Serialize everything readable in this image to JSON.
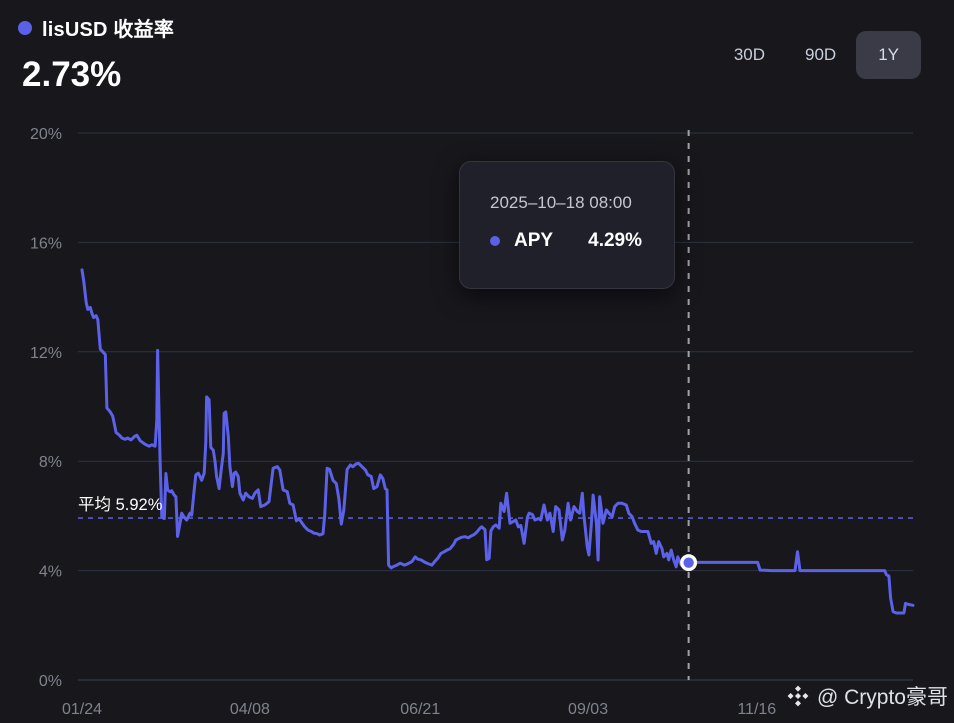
{
  "header": {
    "title": "lisUSD 收益率",
    "value": "2.73%",
    "ranges": [
      {
        "label": "30D",
        "active": false
      },
      {
        "label": "90D",
        "active": false
      },
      {
        "label": "1Y",
        "active": true
      }
    ]
  },
  "tooltip": {
    "date": "2025–10–18 08:00",
    "series": "APY",
    "value": "4.29%"
  },
  "average": {
    "label": "平均 5.92%",
    "value": 5.92
  },
  "watermark": {
    "icon": "binance-diamond-icon",
    "text": "@ Crypto豪哥"
  },
  "colors": {
    "background": "#17171c",
    "accent": "#5c62e8",
    "grid": "#2d3543",
    "axis_text": "#80838d",
    "crosshair": "#b9bbc3",
    "active_button_bg": "#3a3b47"
  },
  "chart_data": {
    "type": "line",
    "title": "lisUSD 收益率",
    "series_name": "APY",
    "unit": "%",
    "ylim": [
      0,
      20
    ],
    "grid": true,
    "y_ticks": [
      {
        "label": "20%",
        "value": 20
      },
      {
        "label": "16%",
        "value": 16
      },
      {
        "label": "12%",
        "value": 12
      },
      {
        "label": "8%",
        "value": 8
      },
      {
        "label": "4%",
        "value": 4
      },
      {
        "label": "0%",
        "value": 0
      }
    ],
    "x_ticks": [
      {
        "label": "01/24",
        "f": 0.0
      },
      {
        "label": "04/08",
        "f": 0.202
      },
      {
        "label": "06/21",
        "f": 0.407
      },
      {
        "label": "09/03",
        "f": 0.609
      },
      {
        "label": "11/16",
        "f": 0.812
      }
    ],
    "average": 5.92,
    "highlight": {
      "f": 0.73,
      "value": 4.29,
      "date": "2025-10-18 08:00"
    },
    "points": [
      [
        0.0,
        15.0
      ],
      [
        0.002,
        14.6
      ],
      [
        0.005,
        13.8
      ],
      [
        0.007,
        13.55
      ],
      [
        0.01,
        13.62
      ],
      [
        0.012,
        13.4
      ],
      [
        0.014,
        13.25
      ],
      [
        0.017,
        13.32
      ],
      [
        0.019,
        13.18
      ],
      [
        0.022,
        12.1
      ],
      [
        0.025,
        12.0
      ],
      [
        0.028,
        11.9
      ],
      [
        0.03,
        9.95
      ],
      [
        0.034,
        9.8
      ],
      [
        0.037,
        9.65
      ],
      [
        0.041,
        9.05
      ],
      [
        0.045,
        8.95
      ],
      [
        0.048,
        8.85
      ],
      [
        0.052,
        8.8
      ],
      [
        0.055,
        8.85
      ],
      [
        0.059,
        8.78
      ],
      [
        0.063,
        8.9
      ],
      [
        0.066,
        8.95
      ],
      [
        0.07,
        8.75
      ],
      [
        0.073,
        8.68
      ],
      [
        0.077,
        8.6
      ],
      [
        0.081,
        8.55
      ],
      [
        0.084,
        8.6
      ],
      [
        0.088,
        8.55
      ],
      [
        0.09,
        9.5
      ],
      [
        0.091,
        12.05
      ],
      [
        0.094,
        8.0
      ],
      [
        0.096,
        5.95
      ],
      [
        0.099,
        5.9
      ],
      [
        0.101,
        7.55
      ],
      [
        0.103,
        6.95
      ],
      [
        0.106,
        6.88
      ],
      [
        0.108,
        6.92
      ],
      [
        0.111,
        6.76
      ],
      [
        0.113,
        6.7
      ],
      [
        0.115,
        5.25
      ],
      [
        0.118,
        5.75
      ],
      [
        0.12,
        6.1
      ],
      [
        0.123,
        5.95
      ],
      [
        0.126,
        5.85
      ],
      [
        0.13,
        6.1
      ],
      [
        0.132,
        6.03
      ],
      [
        0.135,
        6.95
      ],
      [
        0.137,
        7.5
      ],
      [
        0.14,
        7.56
      ],
      [
        0.142,
        7.44
      ],
      [
        0.144,
        7.3
      ],
      [
        0.147,
        7.56
      ],
      [
        0.149,
        8.7
      ],
      [
        0.15,
        10.35
      ],
      [
        0.153,
        10.25
      ],
      [
        0.155,
        8.5
      ],
      [
        0.158,
        8.4
      ],
      [
        0.16,
        8.0
      ],
      [
        0.162,
        7.44
      ],
      [
        0.165,
        7.0
      ],
      [
        0.167,
        7.56
      ],
      [
        0.17,
        8.3
      ],
      [
        0.171,
        9.75
      ],
      [
        0.173,
        9.8
      ],
      [
        0.176,
        8.9
      ],
      [
        0.178,
        7.8
      ],
      [
        0.181,
        7.07
      ],
      [
        0.183,
        7.56
      ],
      [
        0.185,
        7.6
      ],
      [
        0.188,
        7.44
      ],
      [
        0.19,
        6.83
      ],
      [
        0.194,
        6.58
      ],
      [
        0.197,
        6.83
      ],
      [
        0.201,
        6.7
      ],
      [
        0.205,
        6.64
      ],
      [
        0.208,
        6.83
      ],
      [
        0.212,
        6.95
      ],
      [
        0.215,
        6.34
      ],
      [
        0.22,
        6.4
      ],
      [
        0.225,
        6.52
      ],
      [
        0.23,
        7.74
      ],
      [
        0.235,
        7.8
      ],
      [
        0.238,
        7.68
      ],
      [
        0.242,
        6.95
      ],
      [
        0.247,
        6.88
      ],
      [
        0.25,
        6.46
      ],
      [
        0.254,
        6.4
      ],
      [
        0.258,
        5.82
      ],
      [
        0.261,
        5.9
      ],
      [
        0.265,
        5.73
      ],
      [
        0.268,
        5.6
      ],
      [
        0.272,
        5.48
      ],
      [
        0.276,
        5.43
      ],
      [
        0.279,
        5.37
      ],
      [
        0.283,
        5.35
      ],
      [
        0.286,
        5.3
      ],
      [
        0.29,
        5.35
      ],
      [
        0.292,
        6.03
      ],
      [
        0.295,
        7.74
      ],
      [
        0.298,
        7.7
      ],
      [
        0.302,
        7.3
      ],
      [
        0.306,
        7.18
      ],
      [
        0.309,
        6.64
      ],
      [
        0.312,
        5.7
      ],
      [
        0.315,
        6.2
      ],
      [
        0.319,
        7.7
      ],
      [
        0.323,
        7.86
      ],
      [
        0.326,
        7.8
      ],
      [
        0.33,
        7.9
      ],
      [
        0.333,
        7.92
      ],
      [
        0.337,
        7.8
      ],
      [
        0.341,
        7.68
      ],
      [
        0.344,
        7.5
      ],
      [
        0.348,
        7.44
      ],
      [
        0.351,
        7.0
      ],
      [
        0.355,
        7.07
      ],
      [
        0.359,
        7.5
      ],
      [
        0.362,
        7.37
      ],
      [
        0.365,
        7.0
      ],
      [
        0.367,
        6.95
      ],
      [
        0.369,
        4.2
      ],
      [
        0.372,
        4.1
      ],
      [
        0.375,
        4.15
      ],
      [
        0.379,
        4.2
      ],
      [
        0.383,
        4.27
      ],
      [
        0.388,
        4.2
      ],
      [
        0.392,
        4.25
      ],
      [
        0.397,
        4.33
      ],
      [
        0.401,
        4.5
      ],
      [
        0.404,
        4.42
      ],
      [
        0.408,
        4.39
      ],
      [
        0.413,
        4.3
      ],
      [
        0.416,
        4.26
      ],
      [
        0.421,
        4.2
      ],
      [
        0.425,
        4.35
      ],
      [
        0.428,
        4.45
      ],
      [
        0.432,
        4.63
      ],
      [
        0.436,
        4.69
      ],
      [
        0.439,
        4.75
      ],
      [
        0.443,
        4.8
      ],
      [
        0.447,
        4.95
      ],
      [
        0.45,
        5.12
      ],
      [
        0.454,
        5.18
      ],
      [
        0.457,
        5.22
      ],
      [
        0.461,
        5.24
      ],
      [
        0.465,
        5.2
      ],
      [
        0.468,
        5.26
      ],
      [
        0.472,
        5.32
      ],
      [
        0.475,
        5.4
      ],
      [
        0.479,
        5.55
      ],
      [
        0.481,
        5.6
      ],
      [
        0.485,
        5.5
      ],
      [
        0.487,
        4.4
      ],
      [
        0.49,
        4.45
      ],
      [
        0.492,
        5.45
      ],
      [
        0.495,
        5.6
      ],
      [
        0.498,
        5.67
      ],
      [
        0.502,
        5.55
      ],
      [
        0.504,
        6.46
      ],
      [
        0.508,
        6.16
      ],
      [
        0.511,
        6.83
      ],
      [
        0.515,
        5.73
      ],
      [
        0.519,
        5.8
      ],
      [
        0.522,
        5.85
      ],
      [
        0.525,
        5.6
      ],
      [
        0.528,
        5.65
      ],
      [
        0.532,
        5.0
      ],
      [
        0.536,
        5.95
      ],
      [
        0.538,
        6.1
      ],
      [
        0.542,
        6.05
      ],
      [
        0.545,
        5.85
      ],
      [
        0.549,
        5.9
      ],
      [
        0.552,
        5.85
      ],
      [
        0.556,
        6.4
      ],
      [
        0.56,
        5.85
      ],
      [
        0.563,
        6.1
      ],
      [
        0.567,
        5.43
      ],
      [
        0.57,
        6.34
      ],
      [
        0.574,
        6.22
      ],
      [
        0.578,
        5.12
      ],
      [
        0.581,
        5.48
      ],
      [
        0.585,
        6.46
      ],
      [
        0.588,
        5.85
      ],
      [
        0.592,
        6.34
      ],
      [
        0.596,
        6.16
      ],
      [
        0.599,
        6.1
      ],
      [
        0.602,
        6.83
      ],
      [
        0.604,
        6.03
      ],
      [
        0.608,
        4.88
      ],
      [
        0.61,
        4.57
      ],
      [
        0.613,
        5.73
      ],
      [
        0.615,
        6.76
      ],
      [
        0.619,
        5.73
      ],
      [
        0.621,
        4.39
      ],
      [
        0.623,
        6.7
      ],
      [
        0.627,
        5.73
      ],
      [
        0.631,
        6.22
      ],
      [
        0.634,
        6.1
      ],
      [
        0.638,
        5.97
      ],
      [
        0.641,
        6.34
      ],
      [
        0.645,
        6.46
      ],
      [
        0.65,
        6.46
      ],
      [
        0.655,
        6.4
      ],
      [
        0.658,
        6.1
      ],
      [
        0.662,
        5.97
      ],
      [
        0.665,
        5.73
      ],
      [
        0.669,
        5.48
      ],
      [
        0.673,
        5.43
      ],
      [
        0.677,
        5.43
      ],
      [
        0.681,
        5.43
      ],
      [
        0.685,
        5.0
      ],
      [
        0.688,
        5.06
      ],
      [
        0.691,
        4.63
      ],
      [
        0.694,
        5.06
      ],
      [
        0.698,
        4.8
      ],
      [
        0.7,
        4.5
      ],
      [
        0.704,
        4.63
      ],
      [
        0.706,
        4.39
      ],
      [
        0.709,
        4.75
      ],
      [
        0.712,
        4.39
      ],
      [
        0.715,
        4.14
      ],
      [
        0.717,
        4.5
      ],
      [
        0.721,
        4.2
      ],
      [
        0.724,
        4.32
      ],
      [
        0.728,
        4.26
      ],
      [
        0.73,
        4.29
      ],
      [
        0.74,
        4.3
      ],
      [
        0.76,
        4.3
      ],
      [
        0.78,
        4.3
      ],
      [
        0.813,
        4.3
      ],
      [
        0.816,
        4.02
      ],
      [
        0.83,
        4.0
      ],
      [
        0.845,
        4.0
      ],
      [
        0.858,
        4.0
      ],
      [
        0.861,
        4.69
      ],
      [
        0.864,
        4.0
      ],
      [
        0.882,
        4.0
      ],
      [
        0.9,
        4.0
      ],
      [
        0.92,
        4.0
      ],
      [
        0.94,
        4.0
      ],
      [
        0.955,
        4.0
      ],
      [
        0.966,
        4.0
      ],
      [
        0.968,
        3.85
      ],
      [
        0.971,
        3.8
      ],
      [
        0.973,
        3.0
      ],
      [
        0.976,
        2.5
      ],
      [
        0.98,
        2.45
      ],
      [
        0.986,
        2.45
      ],
      [
        0.989,
        2.45
      ],
      [
        0.991,
        2.8
      ],
      [
        0.995,
        2.76
      ],
      [
        1.0,
        2.73
      ]
    ]
  }
}
